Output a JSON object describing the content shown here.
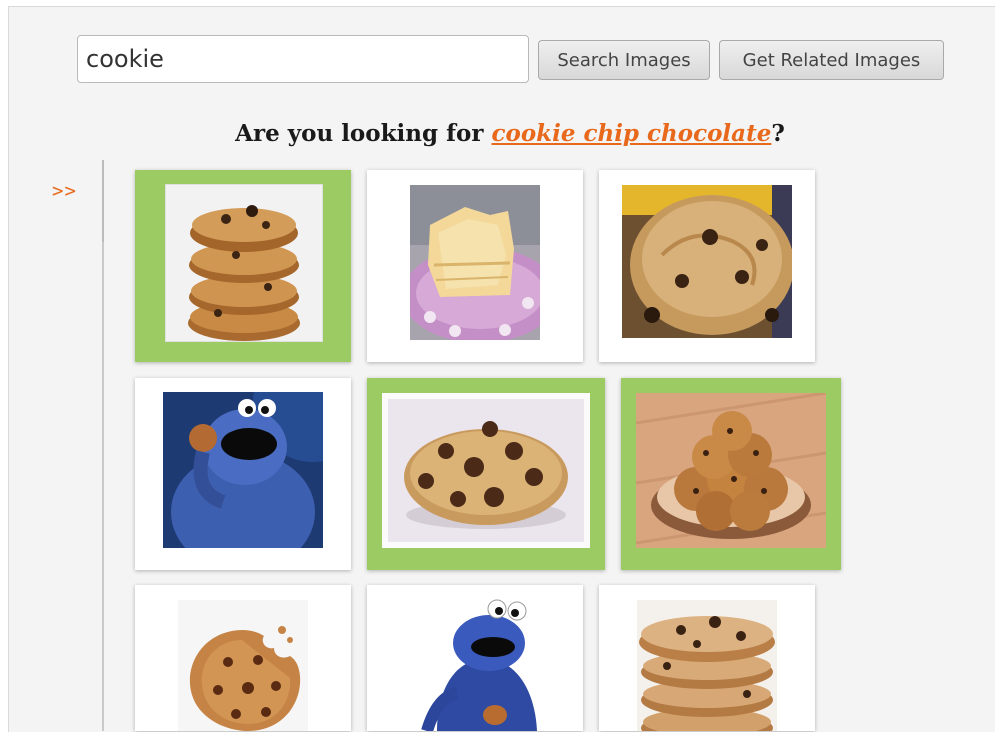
{
  "search": {
    "value": "cookie",
    "search_button_label": "Search Images",
    "related_button_label": "Get Related Images"
  },
  "suggestion": {
    "prefix": "Are you looking for ",
    "link_text": "cookie chip chocolate",
    "suffix": "?"
  },
  "expand_toggle": ">>",
  "grid": {
    "selected_color": "#9ccb63",
    "link_color": "#e8691c",
    "tiles": [
      {
        "subject": "stacked oatmeal chocolate chip cookies",
        "selected": true
      },
      {
        "subject": "sugar cookies on purple plate",
        "selected": false
      },
      {
        "subject": "large chocolate chip cookie close-up",
        "selected": false
      },
      {
        "subject": "cookie monster eating a cookie",
        "selected": false
      },
      {
        "subject": "single chocolate chip cookie",
        "selected": true
      },
      {
        "subject": "plate of chocolate chip cookies",
        "selected": true
      },
      {
        "subject": "bitten chocolate chip cookie",
        "selected": false
      },
      {
        "subject": "cookie monster with cookie",
        "selected": false
      },
      {
        "subject": "stack of chocolate chip cookies",
        "selected": false
      }
    ]
  }
}
